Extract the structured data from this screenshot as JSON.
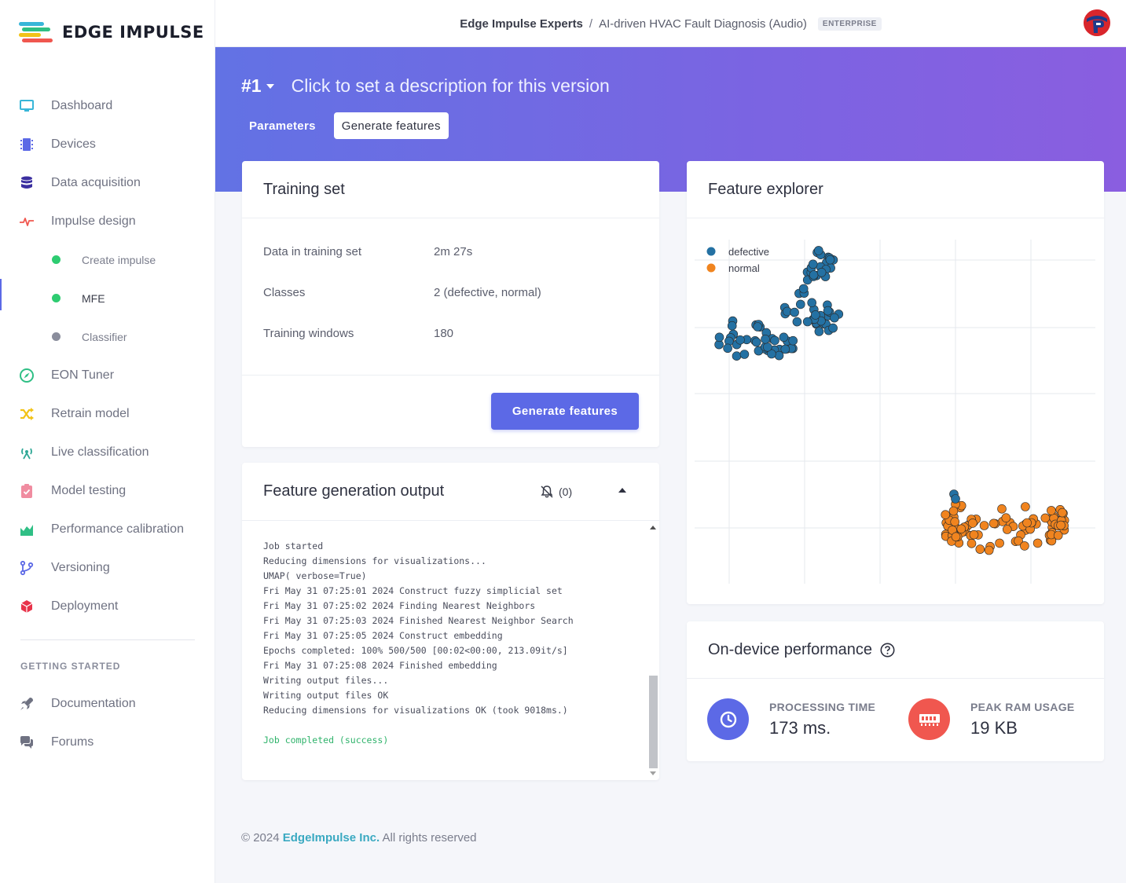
{
  "brand": {
    "logo_text": "EDGE IMPULSE"
  },
  "sidebar": {
    "items": [
      {
        "label": "Dashboard",
        "icon": "monitor-icon",
        "color": "#38b6d8"
      },
      {
        "label": "Devices",
        "icon": "chip-icon",
        "color": "#5c69e6"
      },
      {
        "label": "Data acquisition",
        "icon": "database-icon",
        "color": "#3b2fa0"
      },
      {
        "label": "Impulse design",
        "icon": "pulse-icon",
        "color": "#f0574f"
      }
    ],
    "subitems": [
      {
        "label": "Create impulse",
        "dot": "#2ecc71"
      },
      {
        "label": "MFE",
        "dot": "#2ecc71"
      },
      {
        "label": "Classifier",
        "dot": "#8a8d9c"
      }
    ],
    "items2": [
      {
        "label": "EON Tuner",
        "icon": "compass-icon",
        "color": "#2fbf85"
      },
      {
        "label": "Retrain model",
        "icon": "shuffle-icon",
        "color": "#f2c318"
      },
      {
        "label": "Live classification",
        "icon": "broadcast-icon",
        "color": "#2fa896"
      },
      {
        "label": "Model testing",
        "icon": "clipboard-icon",
        "color": "#f08ca0"
      },
      {
        "label": "Performance calibration",
        "icon": "area-chart-icon",
        "color": "#2fbf85"
      },
      {
        "label": "Versioning",
        "icon": "branch-icon",
        "color": "#5c69e6"
      },
      {
        "label": "Deployment",
        "icon": "cube-icon",
        "color": "#e8334a"
      }
    ],
    "section_label": "GETTING STARTED",
    "items3": [
      {
        "label": "Documentation",
        "icon": "rocket-icon",
        "color": "#6f7282"
      },
      {
        "label": "Forums",
        "icon": "chat-icon",
        "color": "#6f7282"
      }
    ]
  },
  "topbar": {
    "owner": "Edge Impulse Experts",
    "separator": "/",
    "project": "AI-driven HVAC Fault Diagnosis (Audio)",
    "badge": "ENTERPRISE"
  },
  "header": {
    "version": "#1",
    "description": "Click to set a description for this version",
    "tabs": [
      "Parameters",
      "Generate features"
    ]
  },
  "training_set": {
    "title": "Training set",
    "rows": [
      {
        "k": "Data in training set",
        "v": "2m 27s"
      },
      {
        "k": "Classes",
        "v": "2 (defective, normal)"
      },
      {
        "k": "Training windows",
        "v": "180"
      }
    ],
    "button": "Generate features"
  },
  "output": {
    "title": "Feature generation output",
    "notif_count": "(0)",
    "lines": [
      "Job started",
      "Reducing dimensions for visualizations...",
      "UMAP( verbose=True)",
      "Fri May 31 07:25:01 2024 Construct fuzzy simplicial set",
      "Fri May 31 07:25:02 2024 Finding Nearest Neighbors",
      "Fri May 31 07:25:03 2024 Finished Nearest Neighbor Search",
      "Fri May 31 07:25:05 2024 Construct embedding",
      "Epochs completed: 100% 500/500 [00:02<00:00, 213.09it/s]",
      "Fri May 31 07:25:08 2024 Finished embedding",
      "Writing output files...",
      "Writing output files OK",
      "Reducing dimensions for visualizations OK (took 9018ms.)"
    ],
    "status": "Job completed (success)"
  },
  "explorer": {
    "title": "Feature explorer",
    "legend": [
      {
        "label": "defective",
        "color": "#2471a3"
      },
      {
        "label": "normal",
        "color": "#f0841f"
      }
    ]
  },
  "performance": {
    "title": "On-device performance",
    "processing_label": "PROCESSING TIME",
    "processing_value": "173 ms.",
    "ram_label": "PEAK RAM USAGE",
    "ram_value": "19 KB"
  },
  "footer": {
    "copyright": "© 2024",
    "company": "EdgeImpulse Inc.",
    "rights": "All rights reserved"
  },
  "chart_data": {
    "type": "scatter",
    "legend_position": "top-left",
    "grid": true,
    "series": [
      {
        "name": "defective",
        "color": "#2471a3",
        "points": []
      },
      {
        "name": "normal",
        "color": "#f0841f",
        "points": []
      }
    ]
  }
}
